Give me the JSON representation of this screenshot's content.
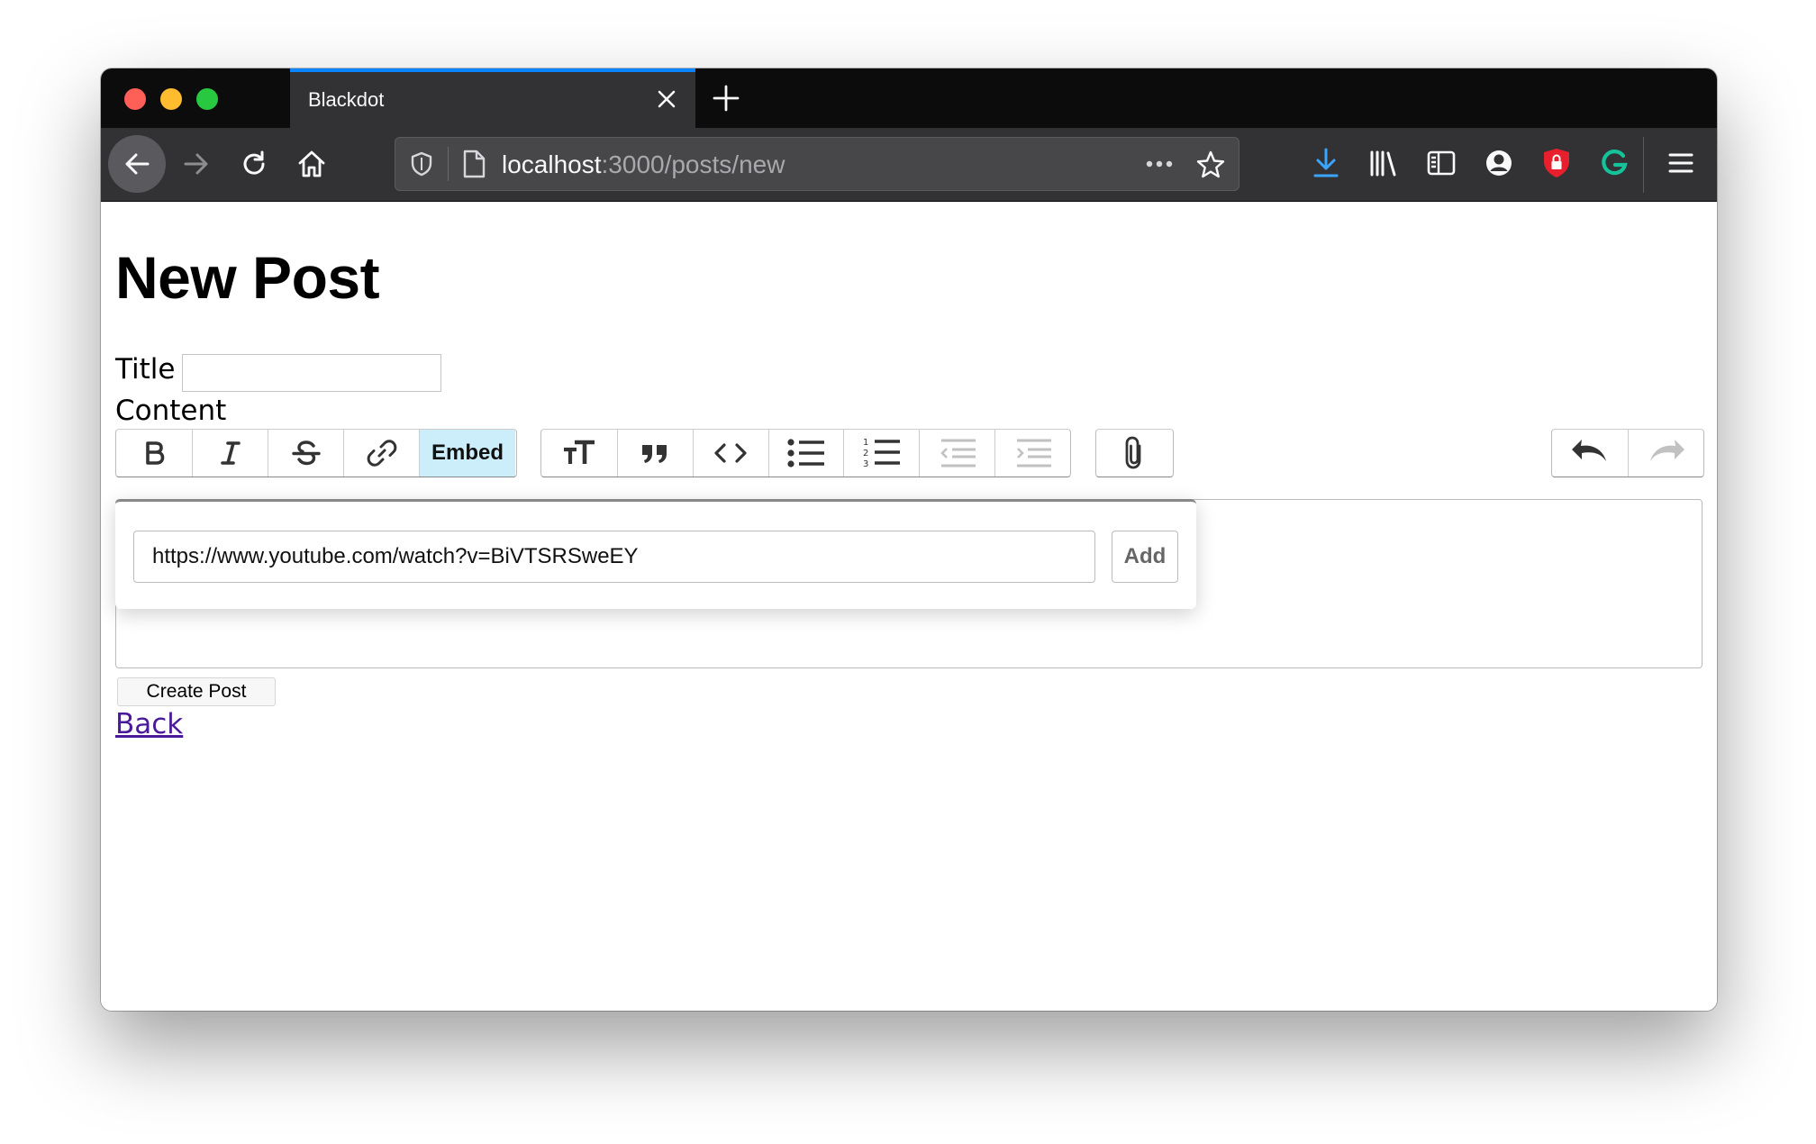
{
  "browser": {
    "tab": {
      "title": "Blackdot"
    },
    "url": {
      "host": "localhost",
      "path": ":3000/posts/new"
    }
  },
  "page": {
    "title": "New Post",
    "title_label": "Title",
    "title_value": "",
    "content_label": "Content"
  },
  "toolbar": {
    "embed_label": "Embed"
  },
  "embed_dialog": {
    "url_value": "https://www.youtube.com/watch?v=BiVTSRSweEY",
    "add_label": "Add"
  },
  "form": {
    "submit_label": "Create Post",
    "back_label": "Back"
  },
  "colors": {
    "accent": "#0a84ff",
    "embed_active_bg": "#cbeefa",
    "link_visited": "#4b1a9a"
  }
}
